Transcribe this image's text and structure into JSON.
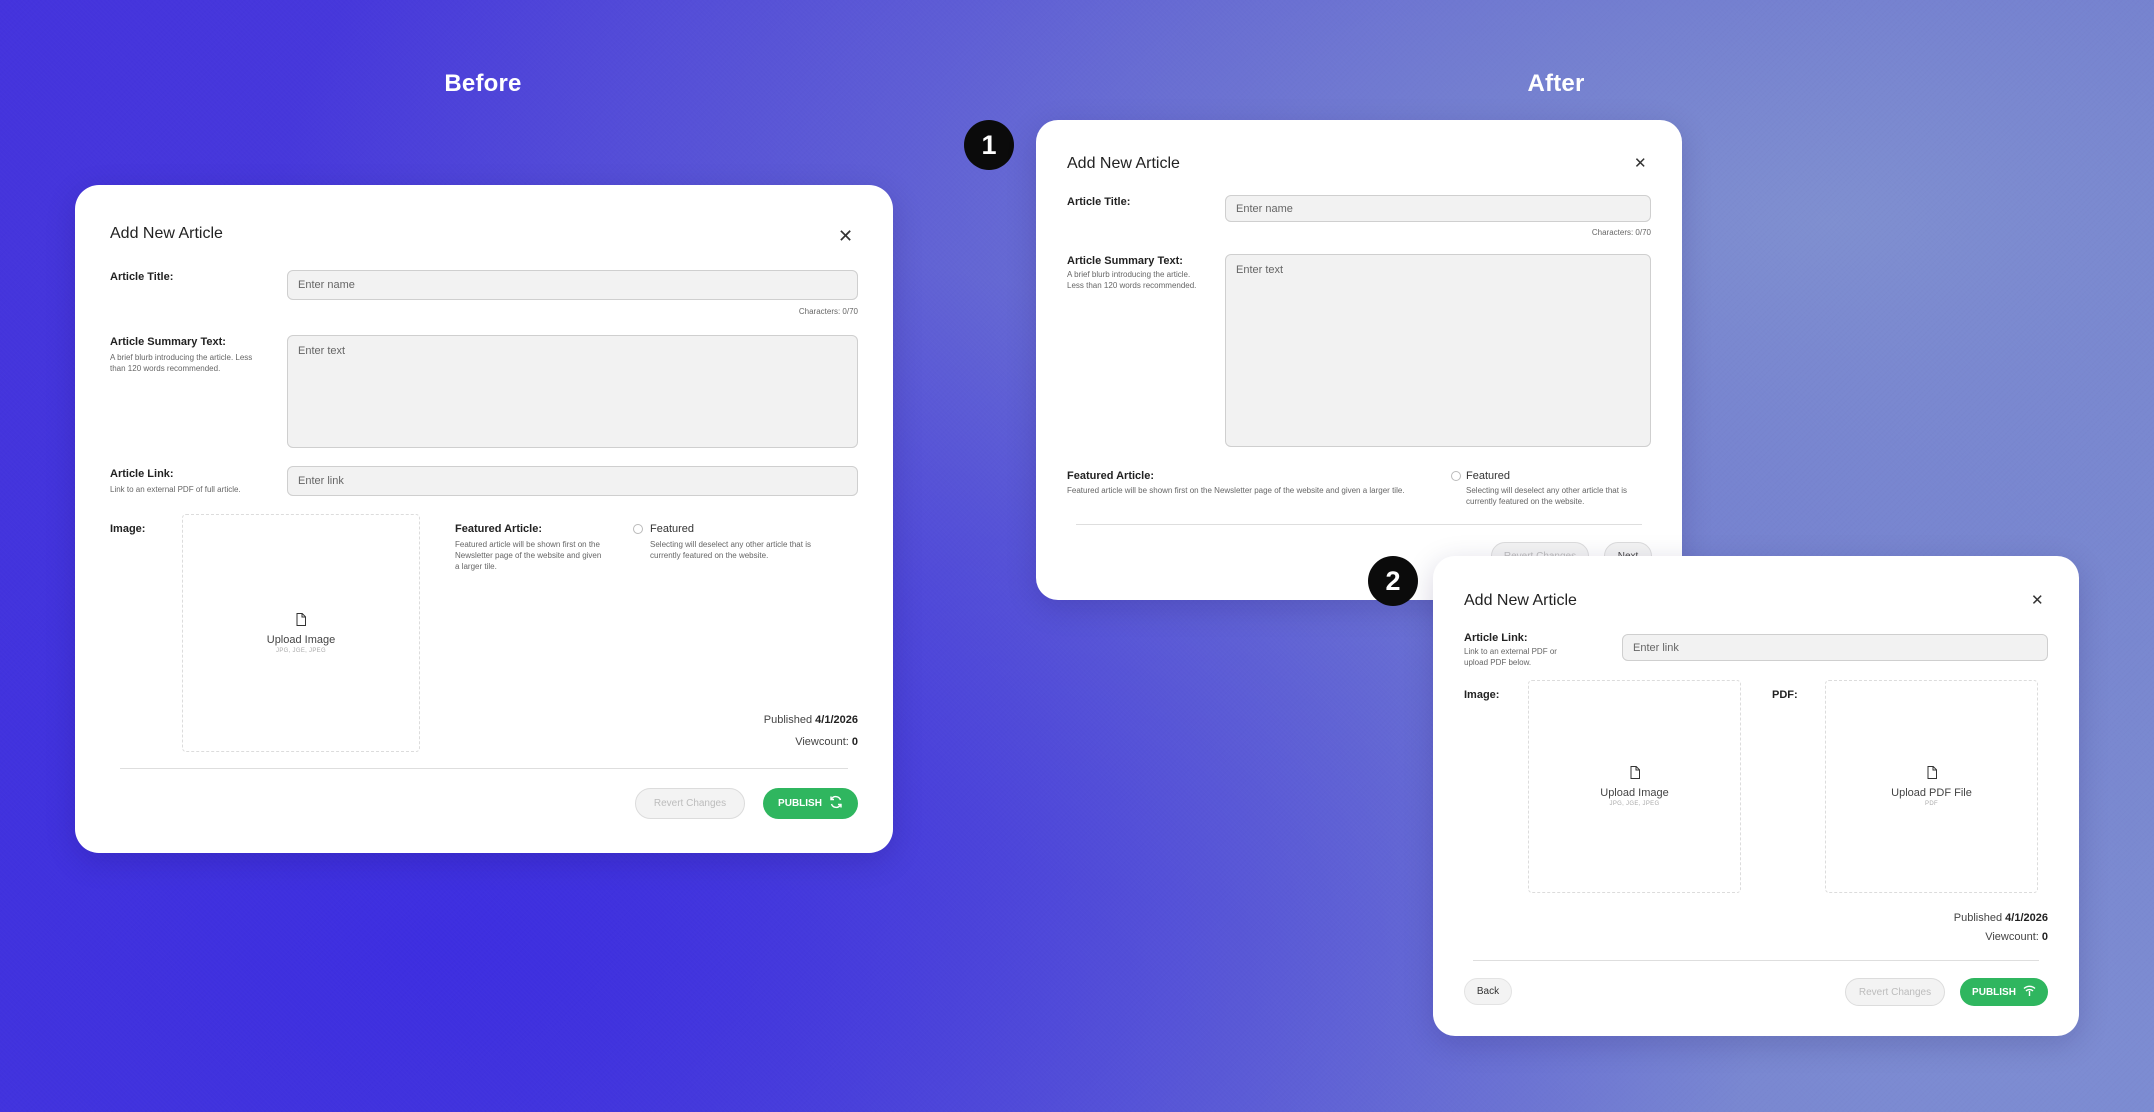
{
  "labels": {
    "before": "Before",
    "after": "After",
    "step1": "1",
    "step2": "2"
  },
  "icons": {
    "close": "close-icon",
    "file": "file-icon",
    "sync": "sync-icon",
    "publish_alt": "broadcast-icon"
  },
  "colors": {
    "accent": "#2fb65f",
    "step_badge": "#0b0b0b",
    "background_start": "#4433dd",
    "background_end": "#7686cd"
  },
  "before_modal": {
    "title": "Add New Article",
    "article_title": {
      "label": "Article Title:",
      "placeholder": "Enter name",
      "counter": "Characters: 0/70"
    },
    "summary": {
      "label": "Article Summary Text:",
      "help": "A brief blurb introducing the article. Less than 120 words recommended.",
      "placeholder": "Enter text"
    },
    "link": {
      "label": "Article Link:",
      "help": "Link to an external PDF of full article.",
      "placeholder": "Enter link"
    },
    "image": {
      "label": "Image:",
      "upload_label": "Upload Image",
      "upload_hint": "JPG, JGE, JPEG"
    },
    "featured": {
      "label": "Featured Article:",
      "help": "Featured article will be shown first on the Newsletter page of the website and given a larger tile.",
      "option": "Featured",
      "option_help": "Selecting will deselect any other article that is currently featured on the website."
    },
    "published_label": "Published",
    "published_date": "4/1/2026",
    "viewcount_label": "Viewcount:",
    "viewcount": "0",
    "revert": "Revert Changes",
    "publish": "PUBLISH"
  },
  "after_step1": {
    "title": "Add New Article",
    "article_title": {
      "label": "Article Title:",
      "placeholder": "Enter name",
      "counter": "Characters: 0/70"
    },
    "summary": {
      "label": "Article Summary Text:",
      "help": "A brief blurb introducing the article. Less than 120 words recommended.",
      "placeholder": "Enter text"
    },
    "featured": {
      "label": "Featured Article:",
      "help": "Featured article will be shown first on the Newsletter page of the website and given a larger tile.",
      "option": "Featured",
      "option_help": "Selecting will deselect any other article that is currently featured on the website."
    },
    "revert": "Revert Changes",
    "next": "Next"
  },
  "after_step2": {
    "title": "Add New Article",
    "link": {
      "label": "Article Link:",
      "help": "Link to an external PDF or upload PDF below.",
      "placeholder": "Enter link"
    },
    "image": {
      "label": "Image:",
      "upload_label": "Upload Image",
      "upload_hint": "JPG, JGE, JPEG"
    },
    "pdf": {
      "label": "PDF:",
      "upload_label": "Upload PDF File",
      "upload_hint": "PDF"
    },
    "published_label": "Published",
    "published_date": "4/1/2026",
    "viewcount_label": "Viewcount:",
    "viewcount": "0",
    "back": "Back",
    "revert": "Revert Changes",
    "publish": "PUBLISH"
  }
}
